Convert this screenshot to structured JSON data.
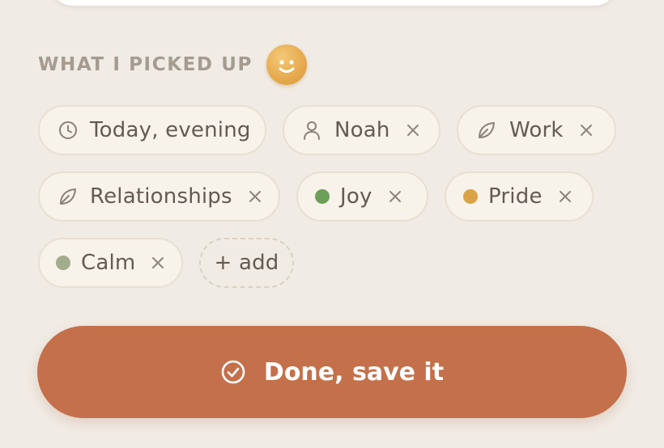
{
  "section": {
    "title": "WHAT I PICKED UP",
    "mascot_icon": "smiley-icon"
  },
  "chips": {
    "time": {
      "label": "Today, evening",
      "icon": "clock-icon"
    },
    "person": {
      "label": "Noah",
      "icon": "person-icon"
    },
    "work": {
      "label": "Work",
      "icon": "leaf-icon"
    },
    "relationships": {
      "label": "Relationships",
      "icon": "leaf-icon"
    },
    "joy": {
      "label": "Joy",
      "color": "#6e9f59"
    },
    "pride": {
      "label": "Pride",
      "color": "#d9a346"
    },
    "calm": {
      "label": "Calm",
      "color": "#a3ad8c"
    },
    "add": {
      "label": "+ add"
    }
  },
  "done_button": {
    "label": "Done, save it",
    "icon": "check-circle-icon",
    "color": "#c4704b"
  }
}
